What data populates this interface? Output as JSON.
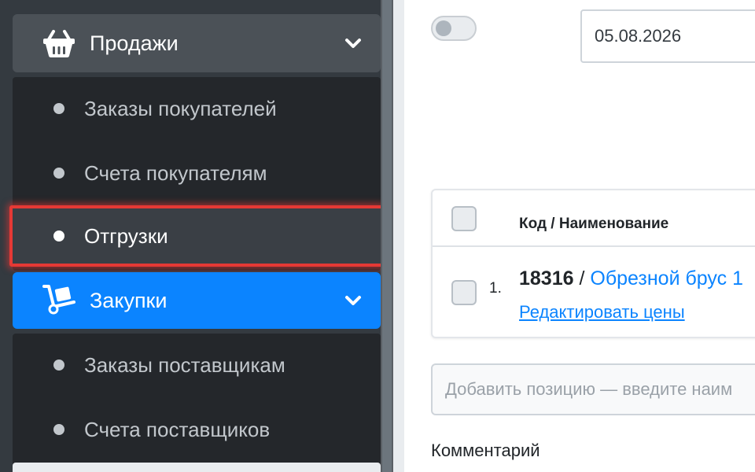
{
  "sidebar": {
    "groups": [
      {
        "label": "Продажи",
        "icon": "basket-icon",
        "expanded": true,
        "items": [
          {
            "label": "Заказы покупателей"
          },
          {
            "label": "Счета покупателям"
          },
          {
            "label": "Отгрузки",
            "active": true
          }
        ]
      },
      {
        "label": "Закупки",
        "icon": "dolly-icon",
        "expanded": true,
        "highlight_color": "#0b84ff",
        "items": [
          {
            "label": "Заказы поставщикам"
          },
          {
            "label": "Счета поставщиков"
          }
        ]
      }
    ]
  },
  "main": {
    "date_value": "05.08.2026",
    "table": {
      "header_code": "Код / Наименование",
      "rows": [
        {
          "num": "1.",
          "code": "18316",
          "separator": " / ",
          "name": "Обрезной брус 1",
          "edit_link": "Редактировать цены"
        }
      ]
    },
    "add_position_placeholder": "Добавить позицию — введите наим",
    "comment_label": "Комментарий"
  },
  "colors": {
    "sidebar_bg": "#343a40",
    "active_outline": "#e53935",
    "accent": "#0b84ff"
  }
}
